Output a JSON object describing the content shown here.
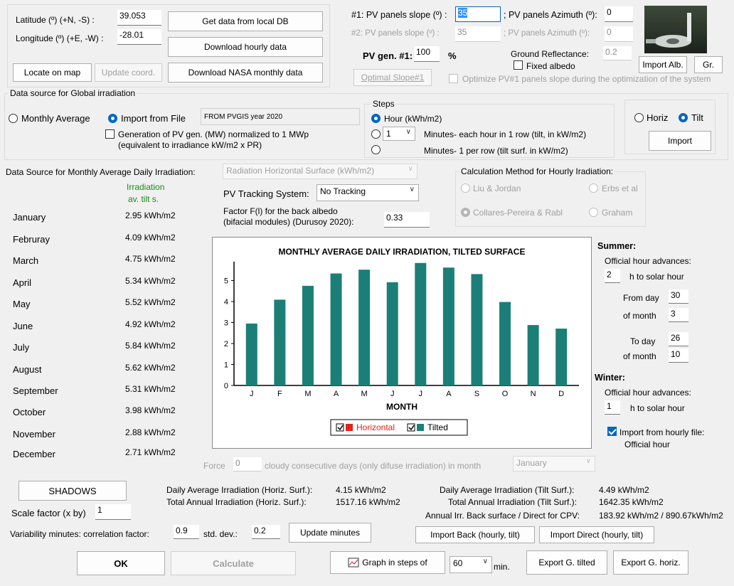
{
  "coords": {
    "lat_label": "Latitude (º) (+N, -S) :",
    "lat_value": "39.053",
    "lon_label": "Longitude (º) (+E, -W) :",
    "lon_value": "-28.01",
    "btn_local_db": "Get data from local DB",
    "btn_hourly": "Download hourly data",
    "btn_locate": "Locate on map",
    "btn_update": "Update coord.",
    "btn_nasa": "Download NASA monthly data"
  },
  "panels": {
    "slope1_label": "#1: PV panels slope (º) :",
    "slope1_value": "35",
    "az1_label": "; PV panels Azimuth (º):",
    "az1_value": "0",
    "slope2_label": "#2: PV panels slope (º) :",
    "slope2_value": "35",
    "az2_label": "; PV panels Azimuth (º):",
    "az2_value": "0",
    "pvgen_label": "PV gen. #1:",
    "pvgen_value": "100",
    "pvgen_unit": "%",
    "reflect_label": "Ground Reflectance:",
    "reflect_value": "0.2",
    "fixed_albedo": "Fixed albedo",
    "btn_import_alb": "Import Alb.",
    "btn_gr": "Gr.",
    "btn_optimal": "Optimal Slope#1",
    "optimize_label": "Optimize PV#1 panels slope during the optimization of the system"
  },
  "source": {
    "group_title": "Data source for Global irradiation",
    "monthly": "Monthly Average",
    "import_file": "Import from File",
    "file_value": "FROM PVGIS year 2020",
    "gen_pv": "Generation of PV gen. (MW) normalized to 1 MWp",
    "gen_pv2": "(equivalent to irradiance kW/m2 x PR)",
    "steps_title": "Steps",
    "step_hour": "Hour  (kWh/m2)",
    "step_min_value": "1",
    "step_min_row": "Minutes- each hour in 1 row (tilt, in kW/m2)",
    "step_min_per_row": "Minutes- 1 per row (tilt surf. in kW/m2)",
    "horiz": "Horiz",
    "tilt": "Tilt",
    "btn_import": "Import"
  },
  "monthly_src": {
    "label": "Data Source for Monthly Average Daily Irradiation:",
    "value": "Radiation Horizontal Surface (kWh/m2)",
    "col_header1": "Irradiation",
    "col_header2": "av. tilt s.",
    "months": [
      {
        "name": "January",
        "value": "2.95 kWh/m2"
      },
      {
        "name": "Februray",
        "value": "4.09 kWh/m2"
      },
      {
        "name": "March",
        "value": "4.75 kWh/m2"
      },
      {
        "name": "April",
        "value": "5.34 kWh/m2"
      },
      {
        "name": "May",
        "value": "5.52 kWh/m2"
      },
      {
        "name": "June",
        "value": "4.92 kWh/m2"
      },
      {
        "name": "July",
        "value": "5.84 kWh/m2"
      },
      {
        "name": "August",
        "value": "5.62 kWh/m2"
      },
      {
        "name": "September",
        "value": "5.31 kWh/m2"
      },
      {
        "name": "October",
        "value": "3.98 kWh/m2"
      },
      {
        "name": "November",
        "value": "2.88 kWh/m2"
      },
      {
        "name": "December",
        "value": "2.71 kWh/m2"
      }
    ]
  },
  "tracking": {
    "label": "PV Tracking System:",
    "value": "No Tracking",
    "factor_label1": "Factor F(l) for the back albedo",
    "factor_label2": "(bifacial modules) (Durusoy 2020):",
    "factor_value": "0.33"
  },
  "calc_method": {
    "title": "Calculation Method for Hourly Iradiation:",
    "liu": "Liu & Jordan",
    "erbs": "Erbs et al",
    "collares": "Collares-Pereira & Rabl",
    "graham": "Graham"
  },
  "summer": {
    "title": "Summer:",
    "advances": "Official hour advances:",
    "hours_value": "2",
    "hours_label": "h to solar hour",
    "from_day_label": "From day",
    "from_day": "30",
    "of_month_label": "of month",
    "from_month": "3",
    "to_day_label": "To day",
    "to_day": "26",
    "to_month": "10"
  },
  "winter": {
    "title": "Winter:",
    "advances": "Official hour advances:",
    "hours_value": "1",
    "hours_label": "h to solar hour",
    "import_hourly": "Import from hourly file:",
    "official_hour": "Official hour"
  },
  "chart_data": {
    "type": "bar",
    "title": "MONTHLY AVERAGE DAILY IRRADIATION, TILTED SURFACE",
    "xlabel": "MONTH",
    "ylabel": "",
    "categories": [
      "J",
      "F",
      "M",
      "A",
      "M",
      "J",
      "J",
      "A",
      "S",
      "O",
      "N",
      "D"
    ],
    "series": [
      {
        "name": "Tilted",
        "values": [
          2.95,
          4.09,
          4.75,
          5.34,
          5.52,
          4.92,
          5.84,
          5.62,
          5.31,
          3.98,
          2.88,
          2.71
        ]
      }
    ],
    "legend": [
      "Horizontal",
      "Tilted"
    ],
    "legend_colors": {
      "Horizontal": "#e8201c",
      "Tilted": "#1b7f77"
    },
    "bar_color": "#1b7f77",
    "ylim": [
      0,
      5.9
    ],
    "yticks": [
      "0",
      "1",
      "2",
      "3",
      "4",
      "5"
    ],
    "legend_placement": "bottom-center",
    "grid": false
  },
  "force": {
    "label1": "Force",
    "value": "0",
    "label2": "cloudy consecutive days (only difuse irradiation) in month",
    "month": "January"
  },
  "summary": {
    "btn_shadows": "SHADOWS",
    "daily_horiz_label": "Daily Average Irradiation (Horiz. Surf.):",
    "daily_horiz": "4.15 kWh/m2",
    "annual_horiz_label": "Total Annual Irradiation (Horiz. Surf.):",
    "annual_horiz": "1517.16 kWh/m2",
    "daily_tilt_label": "Daily Average Irradiation (Tilt Surf.):",
    "daily_tilt": "4.49 kWh/m2",
    "annual_tilt_label": "Total Annual Irradiation (Tilt Surf.):",
    "annual_tilt": "1642.35 kWh/m2",
    "back_label": "Annual Irr. Back surface / Direct for CPV:",
    "back_value": "183.92 kWh/m2 / 890.67kWh/m2",
    "scale_label": "Scale factor (x by)",
    "scale_value": "1",
    "var_label": "Variability minutes: correlation factor:",
    "var_value": "0.9",
    "std_label": "std. dev.:",
    "std_value": "0.2",
    "btn_update_min": "Update minutes",
    "btn_import_back": "Import Back (hourly, tilt)",
    "btn_import_direct": "Import Direct (hourly, tilt)"
  },
  "footer": {
    "ok": "OK",
    "calculate": "Calculate",
    "graph_steps": "Graph in steps of",
    "graph_value": "60",
    "graph_unit": "min.",
    "export_tilt": "Export G. tilted",
    "export_horiz": "Export G. horiz."
  }
}
